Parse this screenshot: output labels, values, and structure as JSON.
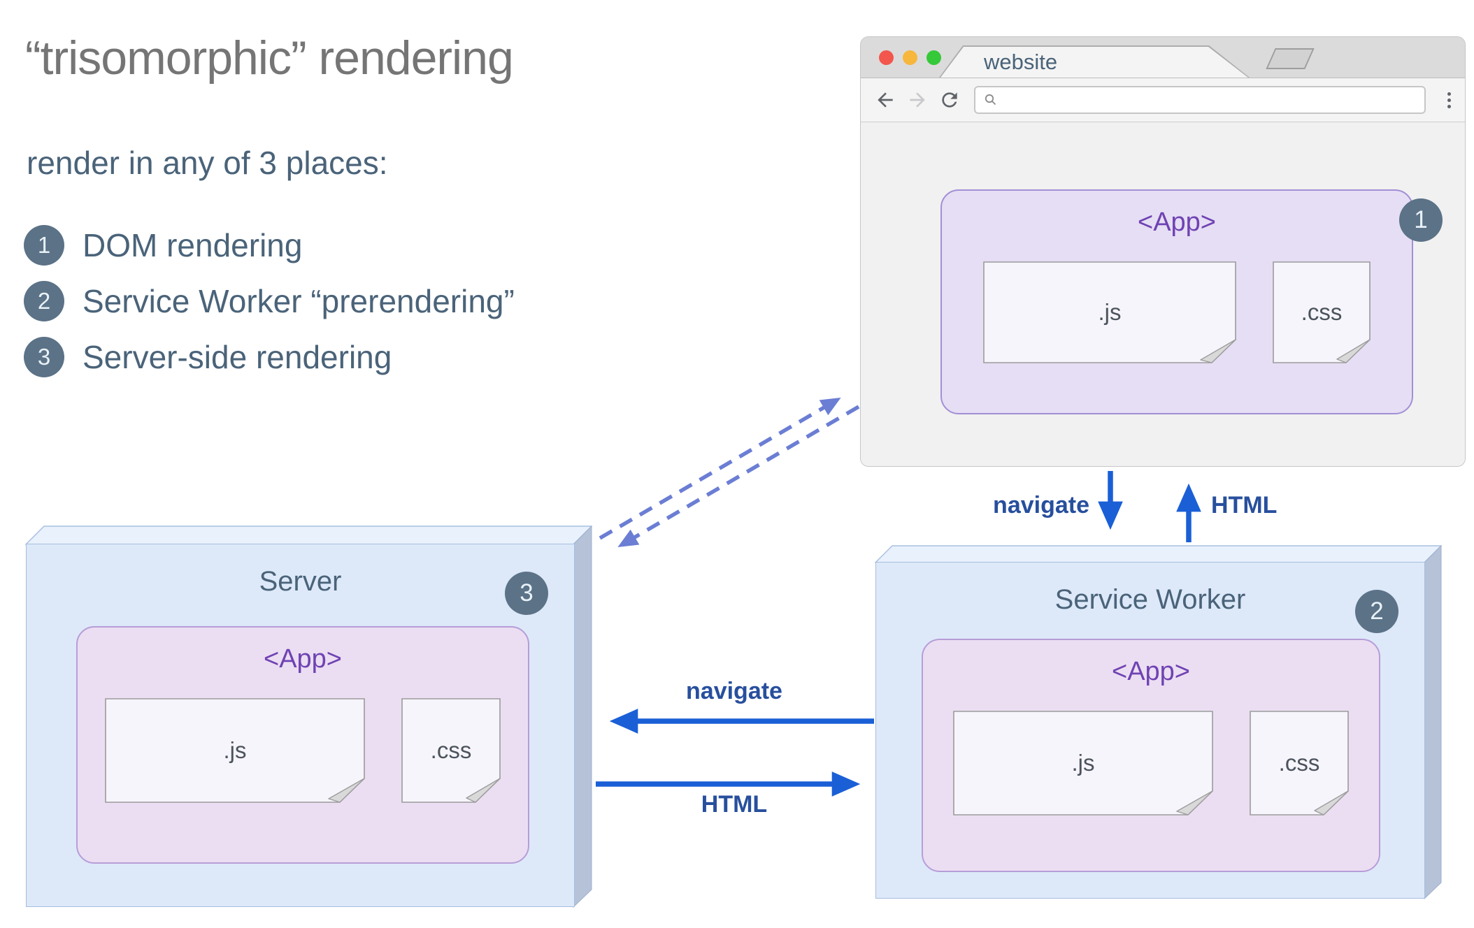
{
  "colors": {
    "title_gray": "#757575",
    "slate": "#4a6379",
    "badge_bg": "#5b7287",
    "badge_text": "#e9f1f8",
    "box_fill": "#dde9f9",
    "box_top": "#e9f1fc",
    "box_side": "#b5c2d8",
    "app_fill": "#e6def4",
    "app_border": "#a28fd6",
    "app_fill_pink": "#ebdef2",
    "app_border_pink": "#b79dd8",
    "purple": "#6f42b3",
    "file_fill": "#f7f5fc",
    "file_border": "#9b9b9b",
    "file_text": "#4b535c",
    "fold_fill": "#d9d9d9",
    "arrow_blue": "#1a5fd6",
    "arrow_label": "#274f9d",
    "dashed_blue": "#6b7ed4",
    "mac_red": "#f2564d",
    "mac_yellow": "#f6b73c",
    "mac_green": "#35c839"
  },
  "header": {
    "title": "“trisomorphic” rendering",
    "subtitle": "render in any of 3 places:",
    "legend": [
      {
        "num": "1",
        "label": "DOM rendering"
      },
      {
        "num": "2",
        "label": "Service Worker “prerendering”"
      },
      {
        "num": "3",
        "label": "Server-side rendering"
      }
    ]
  },
  "browser": {
    "tab_title": "website",
    "badge": "1",
    "app": {
      "title": "<App>",
      "files": [
        ".js",
        ".css"
      ]
    }
  },
  "server_box": {
    "title": "Server",
    "badge": "3",
    "app": {
      "title": "<App>",
      "files": [
        ".js",
        ".css"
      ]
    }
  },
  "service_worker_box": {
    "title": "Service Worker",
    "badge": "2",
    "app": {
      "title": "<App>",
      "files": [
        ".js",
        ".css"
      ]
    }
  },
  "arrows": {
    "navigate_down": "navigate",
    "html_up": "HTML",
    "navigate_left": "navigate",
    "html_right": "HTML"
  }
}
